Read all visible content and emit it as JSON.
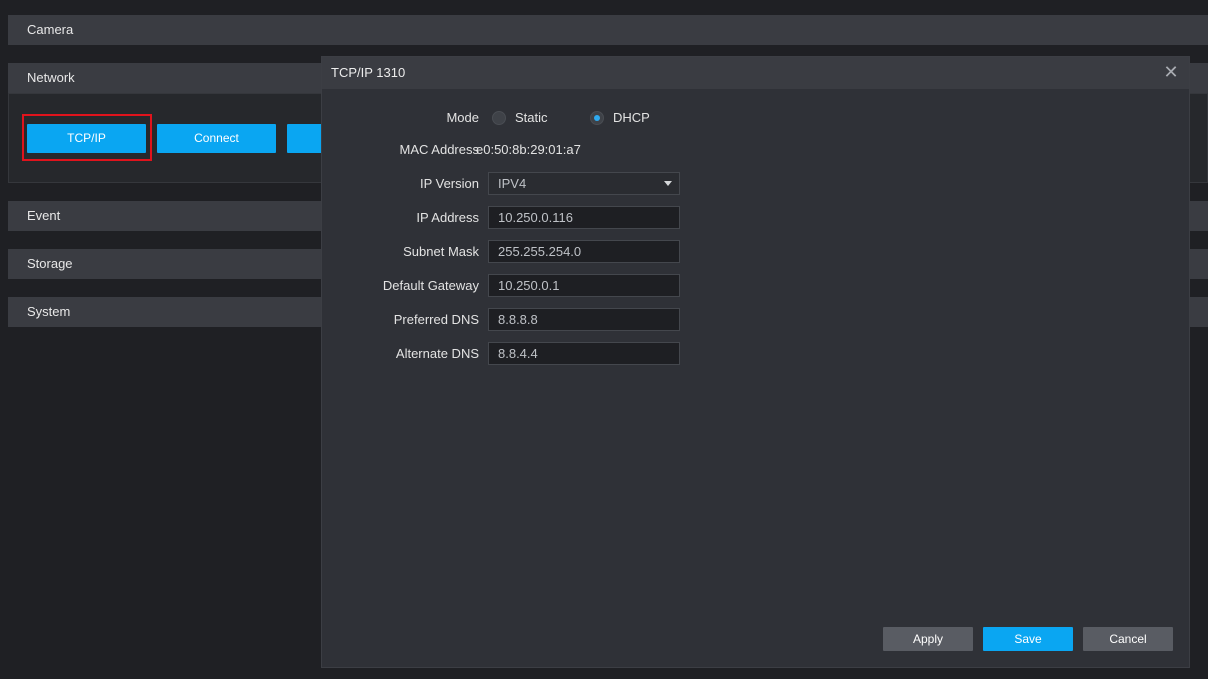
{
  "sections": {
    "camera": "Camera",
    "network": "Network",
    "event": "Event",
    "storage": "Storage",
    "system": "System"
  },
  "network_tabs": {
    "tcpip": "TCP/IP",
    "connect": "Connect"
  },
  "dialog": {
    "title": "TCP/IP 1310",
    "close_glyph": "✕",
    "mode": {
      "label": "Mode",
      "options": [
        "Static",
        "DHCP"
      ],
      "selected": "DHCP"
    },
    "mac": {
      "label": "MAC Address",
      "value": "e0:50:8b:29:01:a7"
    },
    "ip_version": {
      "label": "IP Version",
      "value": "IPV4"
    },
    "ip_address": {
      "label": "IP Address",
      "value": "10.250.0.116"
    },
    "subnet_mask": {
      "label": "Subnet Mask",
      "value": "255.255.254.0"
    },
    "default_gateway": {
      "label": "Default Gateway",
      "value": "10.250.0.1"
    },
    "preferred_dns": {
      "label": "Preferred DNS",
      "value": "8.8.8.8"
    },
    "alternate_dns": {
      "label": "Alternate DNS",
      "value": "8.8.4.4"
    },
    "buttons": {
      "apply": "Apply",
      "save": "Save",
      "cancel": "Cancel"
    }
  },
  "colors": {
    "accent": "#0aa6f2",
    "highlight": "#e0131c",
    "background": "#1f2024",
    "panel": "#2f3137"
  }
}
